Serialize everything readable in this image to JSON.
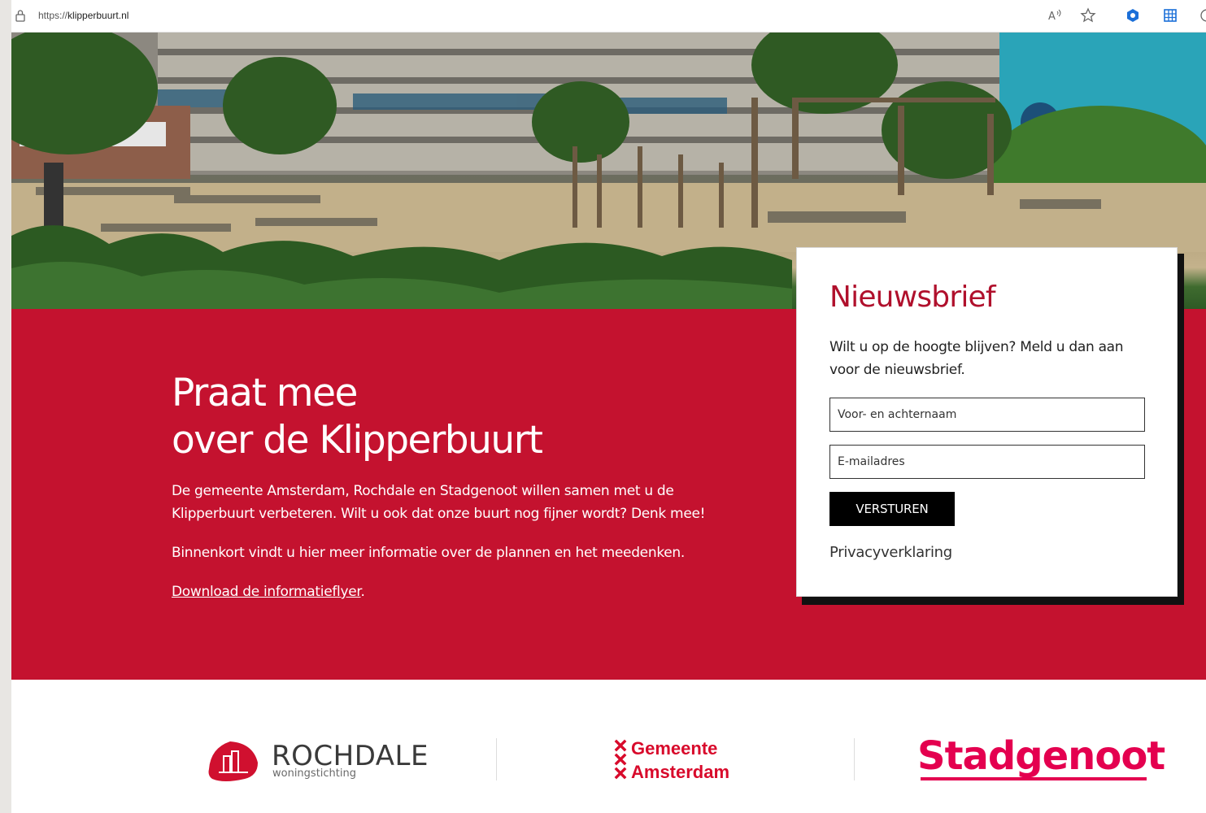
{
  "browser": {
    "url_prefix": "https://",
    "url_host": "klipperbuurt.nl",
    "icons": [
      "lock-icon",
      "read-aloud-icon",
      "favorite-star-icon",
      "extension-icon",
      "apps-grid-icon",
      "profile-icon"
    ]
  },
  "hero": {
    "title_line1": "Praat mee",
    "title_line2": "over de Klipperbuurt",
    "intro": "De gemeente Amsterdam, Rochdale en Stadgenoot willen samen met u de Klipperbuurt verbeteren. Wilt u ook dat onze buurt nog fijner wordt? Denk mee!",
    "soon": "Binnenkort vindt u hier meer informatie over de plannen en het meedenken.",
    "download_link": "Download de informatieflyer",
    "download_suffix": "."
  },
  "newsletter": {
    "title": "Nieuwsbrief",
    "text": "Wilt u op de hoogte blijven? Meld u dan aan voor de nieuwsbrief.",
    "name_placeholder": "Voor- en achternaam",
    "email_placeholder": "E-mailadres",
    "submit_label": "VERSTUREN",
    "privacy_link": "Privacyverklaring"
  },
  "footer": {
    "rochdale_name": "ROCHDALE",
    "rochdale_sub": "woningstichting",
    "amsterdam_line1": "Gemeente",
    "amsterdam_line2": "Amsterdam",
    "stadgenoot": "Stadgenoot"
  },
  "colors": {
    "brand_red": "#c4122f",
    "card_title": "#b0102c",
    "stadgenoot_pink": "#e4004f",
    "amsterdam_red": "#d80a2b"
  }
}
